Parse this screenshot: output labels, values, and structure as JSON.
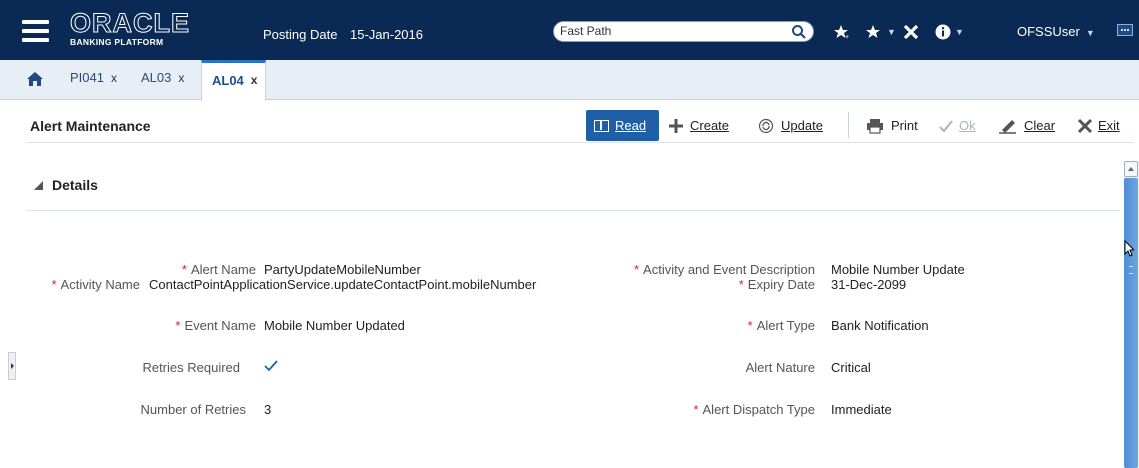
{
  "topbar": {
    "logo_main": "ORACLE",
    "logo_sub": "BANKING PLATFORM",
    "posting_label": "Posting Date",
    "posting_date": "15-Jan-2016",
    "fastpath_placeholder": "Fast Path",
    "user": "OFSSUser",
    "icons": [
      "menu-icon",
      "search-icon",
      "favorite-add-icon",
      "favorites-icon",
      "close-icon",
      "info-icon",
      "screen-icon"
    ]
  },
  "tabs": [
    {
      "label": "PI041",
      "close": "x"
    },
    {
      "label": "AL03",
      "close": "x"
    },
    {
      "label": "AL04",
      "close": "x",
      "active": true
    }
  ],
  "page": {
    "title": "Alert Maintenance"
  },
  "toolbar": {
    "read": "Read",
    "create": "Create",
    "update": "Update",
    "print": "Print",
    "ok": "Ok",
    "clear": "Clear",
    "exit": "Exit"
  },
  "details": {
    "heading": "Details",
    "required_mark": "*",
    "alert_name": {
      "label": "Alert Name",
      "value": "PartyUpdateMobileNumber"
    },
    "activity_name": {
      "label": "Activity Name",
      "value": "ContactPointApplicationService.updateContactPoint.mobileNumber"
    },
    "event_name": {
      "label": "Event Name",
      "value": "Mobile Number Updated"
    },
    "retries_required": {
      "label": "Retries Required",
      "checked": true
    },
    "number_of_retries": {
      "label": "Number of Retries",
      "value": "3"
    },
    "activity_event_desc": {
      "label": "Activity and Event Description",
      "value": "Mobile Number Update"
    },
    "expiry_date": {
      "label": "Expiry Date",
      "value": "31-Dec-2099"
    },
    "alert_type": {
      "label": "Alert Type",
      "value": "Bank Notification"
    },
    "alert_nature": {
      "label": "Alert Nature",
      "value": "Critical"
    },
    "alert_dispatch_type": {
      "label": "Alert Dispatch Type",
      "value": "Immediate"
    }
  },
  "colors": {
    "topbar_bg": "#0a2a55",
    "accent": "#1f5fa8",
    "required": "#dd2222"
  }
}
